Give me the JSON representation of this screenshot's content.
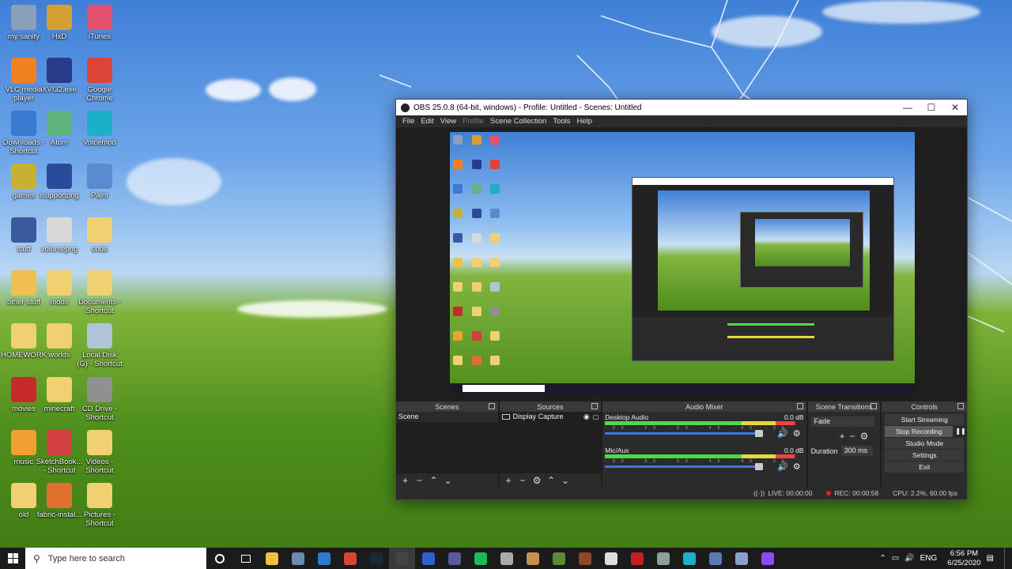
{
  "desktop": {
    "icons": [
      {
        "label": "my sanity",
        "color": "#8aa0b8"
      },
      {
        "label": "HxD",
        "color": "#d4a032"
      },
      {
        "label": "iTunes",
        "color": "#e4506e"
      },
      {
        "label": "VLC media player",
        "color": "#f08020"
      },
      {
        "label": "XVI32.exe",
        "color": "#2a3a8a"
      },
      {
        "label": "Google Chrome",
        "color": "#db4437"
      },
      {
        "label": "Downloads - Shortcut",
        "color": "#3a7ad0"
      },
      {
        "label": "Atom",
        "color": "#5fb57d"
      },
      {
        "label": "Voicemod",
        "color": "#1ab0c8"
      },
      {
        "label": "games",
        "color": "#c8b032"
      },
      {
        "label": "isupportpng",
        "color": "#2a4a9a"
      },
      {
        "label": "Paint",
        "color": "#5a8ad0"
      },
      {
        "label": "stuff",
        "color": "#3a5aa0"
      },
      {
        "label": "volumepng",
        "color": "#d8d8d8"
      },
      {
        "label": "code",
        "color": "#f0d070"
      },
      {
        "label": "other stuff",
        "color": "#f0c050"
      },
      {
        "label": "mods",
        "color": "#f0d070"
      },
      {
        "label": "Documents - Shortcut",
        "color": "#f0d070"
      },
      {
        "label": "HOMEWORK",
        "color": "#f0d070"
      },
      {
        "label": "worlds",
        "color": "#f0d070"
      },
      {
        "label": "Local Disk (G) - Shortcut",
        "color": "#b0c4d8"
      },
      {
        "label": "movies",
        "color": "#c82a2a"
      },
      {
        "label": "minecraft",
        "color": "#f0d070"
      },
      {
        "label": "CD Drive - Shortcut",
        "color": "#909090"
      },
      {
        "label": "music",
        "color": "#f0a030"
      },
      {
        "label": "SketchBook... - Shortcut",
        "color": "#d04040"
      },
      {
        "label": "Videos - Shortcut",
        "color": "#f0d070"
      },
      {
        "label": "old",
        "color": "#f0d070"
      },
      {
        "label": "fabric-instal...",
        "color": "#e07030"
      },
      {
        "label": "Pictures - Shortcut",
        "color": "#f0d070"
      }
    ]
  },
  "obs": {
    "title": "OBS 25.0.8 (64-bit, windows) - Profile: Untitled - Scenes: Untitled",
    "window_buttons": {
      "minimize": "—",
      "maximize": "☐",
      "close": "✕"
    },
    "menu": [
      "File",
      "Edit",
      "View",
      "Profile",
      "Scene Collection",
      "Tools",
      "Help"
    ],
    "docks": {
      "scenes": {
        "title": "Scenes",
        "items": [
          "Scene"
        ]
      },
      "sources": {
        "title": "Sources",
        "items": [
          "Display Capture"
        ]
      },
      "mixer": {
        "title": "Audio Mixer",
        "tracks": [
          {
            "name": "Desktop Audio",
            "db": "0.0 dB",
            "level": 0.99
          },
          {
            "name": "Mic/Aux",
            "db": "0.0 dB",
            "level": 0.99
          }
        ],
        "ticks": "-60 -55 -50 -45 -40 -35 -30 -25 -20 -15 -10 -5 0"
      },
      "transitions": {
        "title": "Scene Transitions",
        "selected": "Fade",
        "duration_label": "Duration",
        "duration_value": "300 ms"
      },
      "controls": {
        "title": "Controls",
        "buttons": [
          "Start Streaming",
          "Stop Recording",
          "Studio Mode",
          "Settings",
          "Exit"
        ],
        "pause_icon": "❚❚"
      }
    },
    "status": {
      "live": "LIVE: 00:00:00",
      "rec": "REC: 00:00:58",
      "cpu": "CPU: 2.2%, 60.00 fps"
    }
  },
  "taskbar": {
    "search_placeholder": "Type here to search",
    "clock_time": "6:56 PM",
    "clock_date": "6/25/2020",
    "apps": [
      {
        "name": "file-explorer",
        "color": "#f0c040"
      },
      {
        "name": "app-2",
        "color": "#6a8ab0"
      },
      {
        "name": "app-3",
        "color": "#2a7ad0"
      },
      {
        "name": "chrome",
        "color": "#db4437"
      },
      {
        "name": "steam",
        "color": "#1b2838"
      },
      {
        "name": "obs",
        "color": "#444"
      },
      {
        "name": "app-7",
        "color": "#3060d0"
      },
      {
        "name": "app-8",
        "color": "#5a5a9a"
      },
      {
        "name": "spotify",
        "color": "#1db954"
      },
      {
        "name": "app-10",
        "color": "#aaa"
      },
      {
        "name": "app-11",
        "color": "#c89050"
      },
      {
        "name": "minecraft",
        "color": "#5a8a3a"
      },
      {
        "name": "app-13",
        "color": "#8a4a2a"
      },
      {
        "name": "app-14",
        "color": "#ddd"
      },
      {
        "name": "app-15",
        "color": "#c02020"
      },
      {
        "name": "app-16",
        "color": "#8aa0a0"
      },
      {
        "name": "app-17",
        "color": "#1ab0c8"
      },
      {
        "name": "app-18",
        "color": "#5a7ab0"
      },
      {
        "name": "app-19",
        "color": "#8aa0c8"
      },
      {
        "name": "twitch",
        "color": "#9146ff"
      }
    ]
  }
}
